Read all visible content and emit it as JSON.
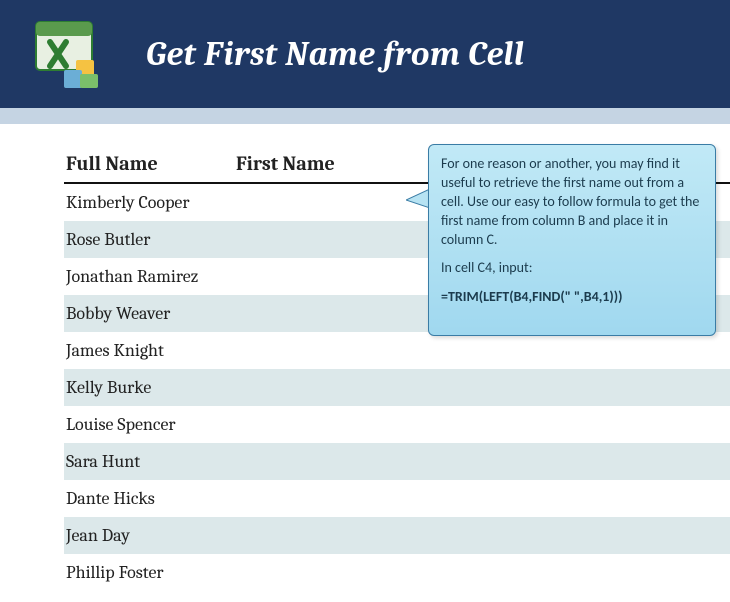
{
  "banner": {
    "title": "Get First Name from Cell"
  },
  "table": {
    "header_full": "Full Name",
    "header_first": "First Name",
    "rows": [
      {
        "full": "Kimberly Cooper",
        "first": ""
      },
      {
        "full": "Rose Butler",
        "first": ""
      },
      {
        "full": "Jonathan Ramirez",
        "first": ""
      },
      {
        "full": "Bobby Weaver",
        "first": ""
      },
      {
        "full": "James Knight",
        "first": ""
      },
      {
        "full": "Kelly Burke",
        "first": ""
      },
      {
        "full": "Louise Spencer",
        "first": ""
      },
      {
        "full": "Sara Hunt",
        "first": ""
      },
      {
        "full": "Dante Hicks",
        "first": ""
      },
      {
        "full": "Jean Day",
        "first": ""
      },
      {
        "full": "Phillip Foster",
        "first": ""
      }
    ]
  },
  "callout": {
    "p1": "For one reason or another, you may find it useful to retrieve the first name out from a cell. Use our easy to follow formula to get the first name from column B and place it in column C.",
    "p2": "In cell C4, input:",
    "formula": "=TRIM(LEFT(B4,FIND(\" \",B4,1)))"
  }
}
